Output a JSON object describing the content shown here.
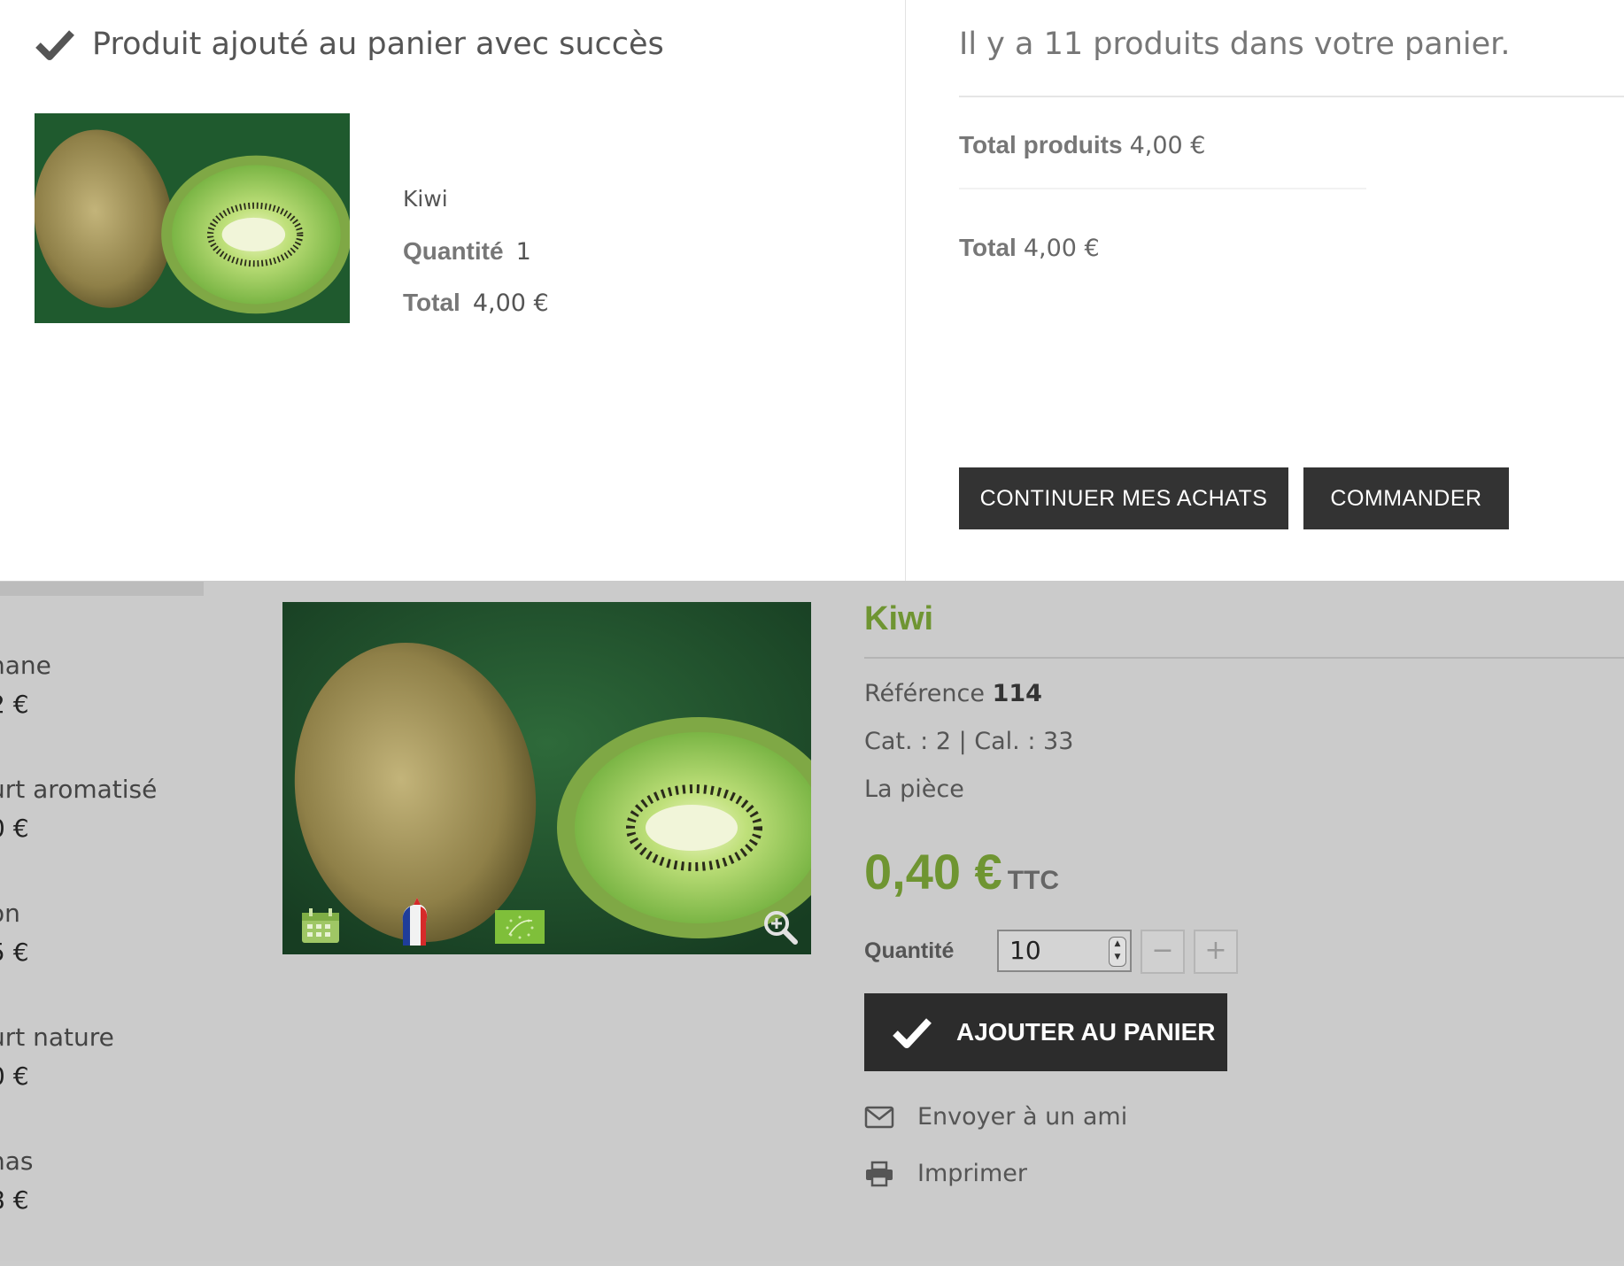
{
  "modal": {
    "success_message": "Produit ajouté au panier avec succès",
    "product": {
      "name": "Kiwi",
      "quantity_label": "Quantité",
      "quantity_value": "1",
      "total_label": "Total",
      "total_value": "4,00 €"
    },
    "cart": {
      "count_text": "Il y a 11 produits dans votre panier.",
      "total_products_label": "Total produits",
      "total_products_value": "4,00 €",
      "total_label": "Total",
      "total_value": "4,00 €"
    },
    "buttons": {
      "continue": "CONTINUER MES ACHATS",
      "order": "COMMANDER"
    }
  },
  "sidebar": {
    "items": [
      {
        "name": "nane",
        "price": "2 €"
      },
      {
        "name": "urt aromatisé",
        "price": "0 €"
      },
      {
        "name": "on",
        "price": "5 €"
      },
      {
        "name": "urt nature",
        "price": "0 €"
      },
      {
        "name": "nas",
        "price": "8 €"
      }
    ]
  },
  "product": {
    "title": "Kiwi",
    "reference_label": "Référence",
    "reference_value": "114",
    "cat_cal_text": "Cat. : 2 | Cal. : 33",
    "unit": "La pièce",
    "price": "0,40 €",
    "tax_label": "TTC",
    "quantity_label": "Quantité",
    "quantity_value": "10",
    "minus_label": "−",
    "plus_label": "+",
    "add_to_cart_label": "AJOUTER AU PANIER",
    "send_friend_label": "Envoyer à un ami",
    "print_label": "Imprimer",
    "image_badges": [
      "calendar-icon",
      "french-rooster-icon",
      "organic-leaf-icon",
      "zoom-in-icon"
    ]
  },
  "colors": {
    "accent_green": "#6f9532",
    "button_dark": "#333333",
    "overlay_gray": "#cbcbcb"
  }
}
